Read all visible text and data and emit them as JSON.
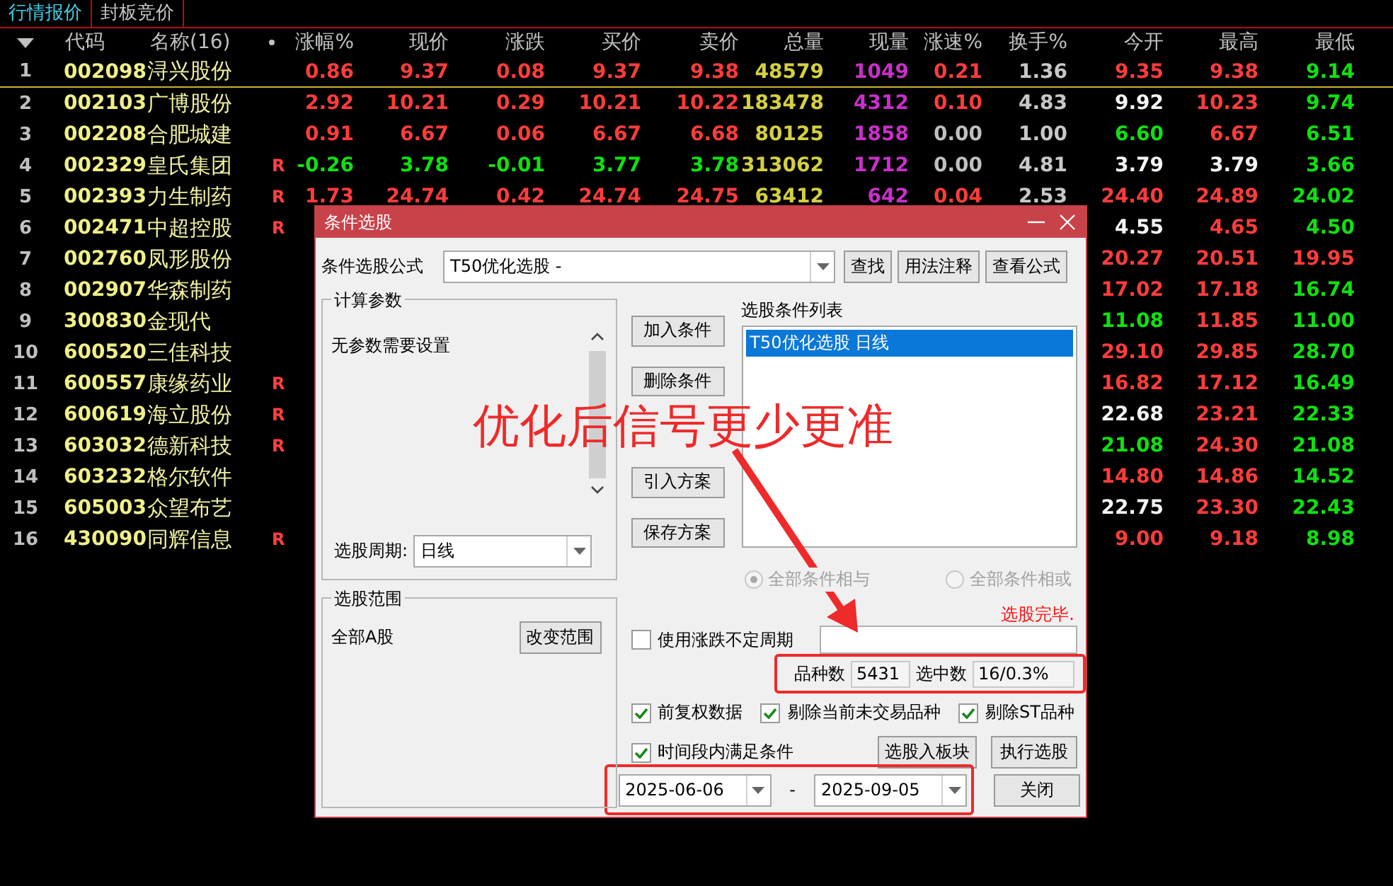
{
  "tabs": [
    {
      "label": "行情报价",
      "selected": true
    },
    {
      "label": "封板竞价",
      "selected": false
    }
  ],
  "table": {
    "columns": [
      {
        "label": "代码",
        "kind": "code"
      },
      {
        "label": "名称(16)",
        "kind": "name"
      },
      {
        "label": "涨幅%",
        "kind": "price"
      },
      {
        "label": "现价",
        "kind": "price"
      },
      {
        "label": "涨跌",
        "kind": "price"
      },
      {
        "label": "买价",
        "kind": "price"
      },
      {
        "label": "卖价",
        "kind": "price"
      },
      {
        "label": "总量",
        "kind": "volume"
      },
      {
        "label": "现量",
        "kind": "current_volume"
      },
      {
        "label": "涨速%",
        "kind": "price"
      },
      {
        "label": "换手%",
        "kind": "turnover"
      },
      {
        "label": "今开",
        "kind": "price"
      },
      {
        "label": "最高",
        "kind": "price"
      },
      {
        "label": "最低",
        "kind": "price"
      }
    ],
    "rows": [
      {
        "index": "1",
        "flag": "",
        "selected": true,
        "cells": [
          {
            "text": "002098"
          },
          {
            "text": "浔兴股份"
          },
          {
            "text": "0.86",
            "color": "#ff3c3c"
          },
          {
            "text": "9.37",
            "color": "#ff3c3c"
          },
          {
            "text": "0.08",
            "color": "#ff3c3c"
          },
          {
            "text": "9.37",
            "color": "#ff3c3c"
          },
          {
            "text": "9.38",
            "color": "#ff3c3c"
          },
          {
            "text": "48579"
          },
          {
            "text": "1049"
          },
          {
            "text": "0.21",
            "color": "#ff3c3c"
          },
          {
            "text": "1.36"
          },
          {
            "text": "9.35",
            "color": "#ff3c3c"
          },
          {
            "text": "9.38",
            "color": "#ff3c3c"
          },
          {
            "text": "9.14",
            "color": "#10e010"
          }
        ]
      },
      {
        "index": "2",
        "flag": "",
        "selected": false,
        "cells": [
          {
            "text": "002103"
          },
          {
            "text": "广博股份"
          },
          {
            "text": "2.92",
            "color": "#ff3c3c"
          },
          {
            "text": "10.21",
            "color": "#ff3c3c"
          },
          {
            "text": "0.29",
            "color": "#ff3c3c"
          },
          {
            "text": "10.21",
            "color": "#ff3c3c"
          },
          {
            "text": "10.22",
            "color": "#ff3c3c"
          },
          {
            "text": "183478"
          },
          {
            "text": "4312"
          },
          {
            "text": "0.10",
            "color": "#ff3c3c"
          },
          {
            "text": "4.83"
          },
          {
            "text": "9.92",
            "color": "#f4f4f4"
          },
          {
            "text": "10.23",
            "color": "#ff3c3c"
          },
          {
            "text": "9.74",
            "color": "#10e010"
          }
        ]
      },
      {
        "index": "3",
        "flag": "",
        "selected": false,
        "cells": [
          {
            "text": "002208"
          },
          {
            "text": "合肥城建"
          },
          {
            "text": "0.91",
            "color": "#ff3c3c"
          },
          {
            "text": "6.67",
            "color": "#ff3c3c"
          },
          {
            "text": "0.06",
            "color": "#ff3c3c"
          },
          {
            "text": "6.67",
            "color": "#ff3c3c"
          },
          {
            "text": "6.68",
            "color": "#ff3c3c"
          },
          {
            "text": "80125"
          },
          {
            "text": "1858"
          },
          {
            "text": "0.00",
            "color": "#c0c0c0"
          },
          {
            "text": "1.00"
          },
          {
            "text": "6.60",
            "color": "#10e010"
          },
          {
            "text": "6.67",
            "color": "#ff3c3c"
          },
          {
            "text": "6.51",
            "color": "#10e010"
          }
        ]
      },
      {
        "index": "4",
        "flag": "R",
        "selected": false,
        "cells": [
          {
            "text": "002329"
          },
          {
            "text": "皇氏集团"
          },
          {
            "text": "-0.26",
            "color": "#10e010"
          },
          {
            "text": "3.78",
            "color": "#10e010"
          },
          {
            "text": "-0.01",
            "color": "#10e010"
          },
          {
            "text": "3.77",
            "color": "#10e010"
          },
          {
            "text": "3.78",
            "color": "#10e010"
          },
          {
            "text": "313062"
          },
          {
            "text": "1712"
          },
          {
            "text": "0.00",
            "color": "#c0c0c0"
          },
          {
            "text": "4.81"
          },
          {
            "text": "3.79",
            "color": "#f4f4f4"
          },
          {
            "text": "3.79",
            "color": "#f4f4f4"
          },
          {
            "text": "3.66",
            "color": "#10e010"
          }
        ]
      },
      {
        "index": "5",
        "flag": "R",
        "selected": false,
        "cells": [
          {
            "text": "002393"
          },
          {
            "text": "力生制药"
          },
          {
            "text": "1.73",
            "color": "#ff3c3c"
          },
          {
            "text": "24.74",
            "color": "#ff3c3c"
          },
          {
            "text": "0.42",
            "color": "#ff3c3c"
          },
          {
            "text": "24.74",
            "color": "#ff3c3c"
          },
          {
            "text": "24.75",
            "color": "#ff3c3c"
          },
          {
            "text": "63412"
          },
          {
            "text": "642"
          },
          {
            "text": "0.04",
            "color": "#ff3c3c"
          },
          {
            "text": "2.53"
          },
          {
            "text": "24.40",
            "color": "#ff3c3c"
          },
          {
            "text": "24.89",
            "color": "#ff3c3c"
          },
          {
            "text": "24.02",
            "color": "#10e010"
          }
        ]
      },
      {
        "index": "6",
        "flag": "R",
        "selected": false,
        "cells": [
          {
            "text": "002471"
          },
          {
            "text": "中超控股"
          },
          null,
          null,
          null,
          null,
          null,
          null,
          null,
          null,
          null,
          {
            "text": "4.55",
            "color": "#f4f4f4"
          },
          {
            "text": "4.65",
            "color": "#ff3c3c"
          },
          {
            "text": "4.50",
            "color": "#10e010"
          }
        ]
      },
      {
        "index": "7",
        "flag": "",
        "selected": false,
        "cells": [
          {
            "text": "002760"
          },
          {
            "text": "凤形股份"
          },
          null,
          null,
          null,
          null,
          null,
          null,
          null,
          null,
          null,
          {
            "text": "20.27",
            "color": "#ff3c3c"
          },
          {
            "text": "20.51",
            "color": "#ff3c3c"
          },
          {
            "text": "19.95",
            "color": "#ff3c3c"
          }
        ]
      },
      {
        "index": "8",
        "flag": "",
        "selected": false,
        "cells": [
          {
            "text": "002907"
          },
          {
            "text": "华森制药"
          },
          null,
          null,
          null,
          null,
          null,
          null,
          null,
          null,
          null,
          {
            "text": "17.02",
            "color": "#ff3c3c"
          },
          {
            "text": "17.18",
            "color": "#ff3c3c"
          },
          {
            "text": "16.74",
            "color": "#10e010"
          }
        ]
      },
      {
        "index": "9",
        "flag": "",
        "selected": false,
        "cells": [
          {
            "text": "300830"
          },
          {
            "text": "金现代"
          },
          null,
          null,
          null,
          null,
          null,
          null,
          null,
          null,
          null,
          {
            "text": "11.08",
            "color": "#10e010"
          },
          {
            "text": "11.85",
            "color": "#ff3c3c"
          },
          {
            "text": "11.00",
            "color": "#10e010"
          }
        ]
      },
      {
        "index": "10",
        "flag": "",
        "selected": false,
        "cells": [
          {
            "text": "600520"
          },
          {
            "text": "三佳科技"
          },
          null,
          null,
          null,
          null,
          null,
          null,
          null,
          null,
          null,
          {
            "text": "29.10",
            "color": "#ff3c3c"
          },
          {
            "text": "29.85",
            "color": "#ff3c3c"
          },
          {
            "text": "28.70",
            "color": "#10e010"
          }
        ]
      },
      {
        "index": "11",
        "flag": "R",
        "selected": false,
        "cells": [
          {
            "text": "600557"
          },
          {
            "text": "康缘药业"
          },
          null,
          null,
          null,
          null,
          null,
          null,
          null,
          null,
          null,
          {
            "text": "16.82",
            "color": "#ff3c3c"
          },
          {
            "text": "17.12",
            "color": "#ff3c3c"
          },
          {
            "text": "16.49",
            "color": "#10e010"
          }
        ]
      },
      {
        "index": "12",
        "flag": "R",
        "selected": false,
        "cells": [
          {
            "text": "600619"
          },
          {
            "text": "海立股份"
          },
          null,
          null,
          null,
          null,
          null,
          null,
          null,
          null,
          null,
          {
            "text": "22.68",
            "color": "#f4f4f4"
          },
          {
            "text": "23.21",
            "color": "#ff3c3c"
          },
          {
            "text": "22.33",
            "color": "#10e010"
          }
        ]
      },
      {
        "index": "13",
        "flag": "R",
        "selected": false,
        "cells": [
          {
            "text": "603032"
          },
          {
            "text": "德新科技"
          },
          null,
          null,
          null,
          null,
          null,
          null,
          null,
          null,
          null,
          {
            "text": "21.08",
            "color": "#10e010"
          },
          {
            "text": "24.30",
            "color": "#ff3c3c"
          },
          {
            "text": "21.08",
            "color": "#10e010"
          }
        ]
      },
      {
        "index": "14",
        "flag": "",
        "selected": false,
        "cells": [
          {
            "text": "603232"
          },
          {
            "text": "格尔软件"
          },
          null,
          null,
          null,
          null,
          null,
          null,
          null,
          null,
          null,
          {
            "text": "14.80",
            "color": "#ff3c3c"
          },
          {
            "text": "14.86",
            "color": "#ff3c3c"
          },
          {
            "text": "14.52",
            "color": "#10e010"
          }
        ]
      },
      {
        "index": "15",
        "flag": "",
        "selected": false,
        "cells": [
          {
            "text": "605003"
          },
          {
            "text": "众望布艺"
          },
          null,
          null,
          null,
          null,
          null,
          null,
          null,
          null,
          null,
          {
            "text": "22.75",
            "color": "#f4f4f4"
          },
          {
            "text": "23.30",
            "color": "#ff3c3c"
          },
          {
            "text": "22.43",
            "color": "#10e010"
          }
        ]
      },
      {
        "index": "16",
        "flag": "R",
        "selected": false,
        "cells": [
          {
            "text": "430090"
          },
          {
            "text": "同辉信息"
          },
          null,
          null,
          null,
          null,
          null,
          null,
          null,
          null,
          null,
          {
            "text": "9.00",
            "color": "#ff3c3c"
          },
          {
            "text": "9.18",
            "color": "#ff3c3c"
          },
          {
            "text": "8.98",
            "color": "#10e010"
          }
        ]
      }
    ]
  },
  "dialog": {
    "title": "条件选股",
    "formula_label": "条件选股公式",
    "formula_value": "T50优化选股  -",
    "top_buttons": [
      "查找",
      "用法注释",
      "查看公式"
    ],
    "params_group": {
      "title": "计算参数",
      "message": "无参数需要设置",
      "period_label": "选股周期:",
      "period_value": "日线"
    },
    "scope_group": {
      "title": "选股范围",
      "value": "全部A股",
      "button": "改变范围"
    },
    "middle_buttons": [
      "加入条件",
      "删除条件",
      "引入方案",
      "保存方案"
    ],
    "conditions": {
      "label": "选股条件列表",
      "items": [
        {
          "text": "T50优化选股  日线",
          "selected": true
        }
      ]
    },
    "logic_options": [
      {
        "label": "全部条件相与",
        "selected": true,
        "disabled": true
      },
      {
        "label": "全部条件相或",
        "selected": false,
        "disabled": true
      }
    ],
    "status": "选股完毕.",
    "variable_period": {
      "label": "使用涨跌不定周期",
      "checked": false
    },
    "count_label": "品种数",
    "count_value": "5431",
    "selected_label": "选中数",
    "selected_value": "16/0.3%",
    "options": [
      {
        "label": "前复权数据",
        "checked": true
      },
      {
        "label": "剔除当前未交易品种",
        "checked": true
      },
      {
        "label": "剔除ST品种",
        "checked": true
      }
    ],
    "period_option": {
      "label": "时间段内满足条件",
      "checked": true
    },
    "action_buttons": [
      "选股入板块",
      "执行选股"
    ],
    "date_from": "2025-06-06",
    "date_separator": "-",
    "date_to": "2025-09-05",
    "close_button": "关闭"
  },
  "annotation": {
    "text": "优化后信号更少更准"
  }
}
